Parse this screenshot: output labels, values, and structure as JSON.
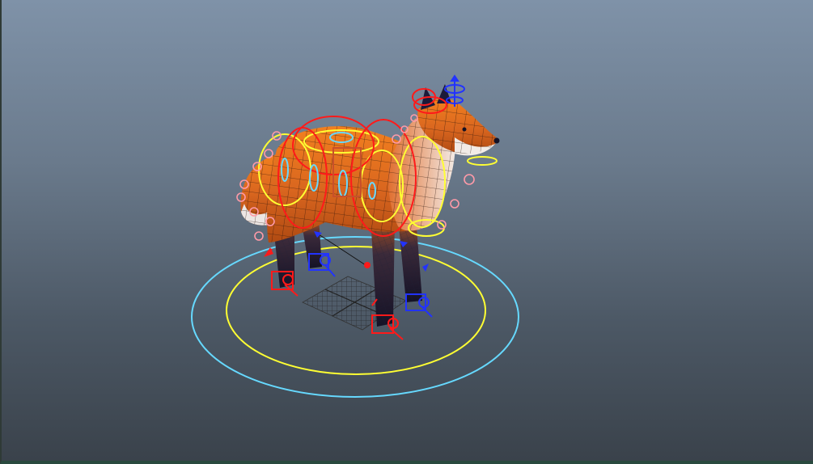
{
  "viewport": {
    "panel": "perspective-viewport",
    "background_top": "#7f92a8",
    "background_bottom": "#3a424b"
  },
  "scene": {
    "subject": "rigged-fox-model",
    "colors": {
      "fur": "#d9661f",
      "fur_light": "#f0e6df",
      "legs": "#1c1a3a",
      "wire": "#1a0f08",
      "ctrl_red": "#ff1a1a",
      "ctrl_yellow": "#ffff33",
      "ctrl_cyan": "#66d9ff",
      "ctrl_blue": "#2233ff",
      "ctrl_pink": "#ff9aa8",
      "ctrl_brown": "#c8502a"
    },
    "icons": [
      "main-control-circle-icon",
      "root-control-circle-icon",
      "foot-ik-control-icon",
      "ground-grid-icon"
    ]
  }
}
